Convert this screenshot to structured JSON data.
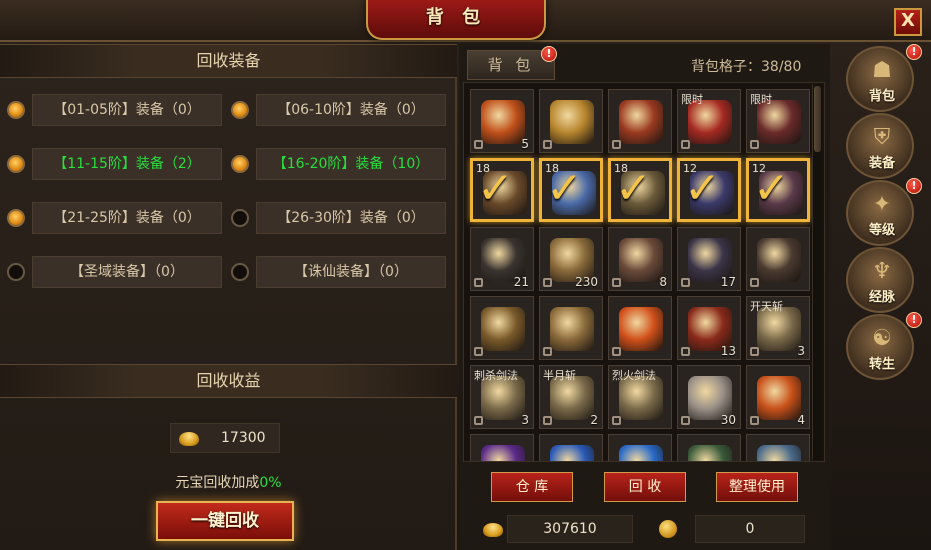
{
  "window": {
    "title": "背 包",
    "close_label": "X"
  },
  "recycle": {
    "section_title": "回收装备",
    "options": [
      {
        "label": "【01-05阶】装备（0）",
        "checked": true,
        "highlight": false
      },
      {
        "label": "【06-10阶】装备（0）",
        "checked": true,
        "highlight": false
      },
      {
        "label": "【11-15阶】装备（2）",
        "checked": true,
        "highlight": true
      },
      {
        "label": "【16-20阶】装备（10）",
        "checked": true,
        "highlight": true
      },
      {
        "label": "【21-25阶】装备（0）",
        "checked": true,
        "highlight": false
      },
      {
        "label": "【26-30阶】装备（0）",
        "checked": false,
        "highlight": false
      },
      {
        "label": "【圣域装备】（0）",
        "checked": false,
        "highlight": false
      },
      {
        "label": "【诛仙装备】（0）",
        "checked": false,
        "highlight": false
      }
    ],
    "income_title": "回收收益",
    "income_value": "17300",
    "bonus_text": "元宝回收加成",
    "bonus_pct": "0%",
    "recycle_all_label": "一键回收"
  },
  "bag": {
    "tab_label": "背 包",
    "capacity_text": "背包格子：38/80",
    "rows": [
      [
        {
          "color": "#c0501a",
          "count": "5"
        },
        {
          "color": "#b8862e",
          "count": ""
        },
        {
          "color": "#9a3a20",
          "count": ""
        },
        {
          "color": "#a52a22",
          "count": "",
          "lvl": "限时"
        },
        {
          "color": "#6a2a2a",
          "count": "",
          "lvl": "限时"
        }
      ],
      [
        {
          "color": "#6a4a2a",
          "count": "",
          "lvl": "18",
          "sel": true
        },
        {
          "color": "#4a6aa8",
          "count": "",
          "lvl": "18",
          "sel": true
        },
        {
          "color": "#6a5a3a",
          "count": "",
          "lvl": "18",
          "sel": true
        },
        {
          "color": "#3a3a6a",
          "count": "",
          "lvl": "12",
          "sel": true
        },
        {
          "color": "#5a3a4a",
          "count": "",
          "lvl": "12",
          "sel": true
        }
      ],
      [
        {
          "color": "#3a3430",
          "count": "21"
        },
        {
          "color": "#8a6a3a",
          "count": "230"
        },
        {
          "color": "#6a4a3a",
          "count": "8"
        },
        {
          "color": "#3a3448",
          "count": "17"
        },
        {
          "color": "#4a3a30",
          "count": ""
        }
      ],
      [
        {
          "color": "#7a5a2a",
          "count": ""
        },
        {
          "color": "#8a6a3a",
          "count": ""
        },
        {
          "color": "#d0501a",
          "count": ""
        },
        {
          "color": "#8a2a1a",
          "count": "13"
        },
        {
          "color": "#7a6a4a",
          "count": "3",
          "lvl": "开天斩"
        }
      ],
      [
        {
          "color": "#7a6a4a",
          "count": "3",
          "lvl": "刺杀剑法"
        },
        {
          "color": "#7a6a4a",
          "count": "2",
          "lvl": "半月斩"
        },
        {
          "color": "#7a6a4a",
          "count": "",
          "lvl": "烈火剑法"
        },
        {
          "color": "#9a9088",
          "count": "30"
        },
        {
          "color": "#c8501a",
          "count": "4"
        }
      ],
      [
        {
          "color": "#5a2a8a",
          "count": ""
        },
        {
          "color": "#2a5ab8",
          "count": ""
        },
        {
          "color": "#2a6ac8",
          "count": ""
        },
        {
          "color": "#3a5a3a",
          "count": ""
        },
        {
          "color": "#4a6a8a",
          "count": ""
        }
      ]
    ],
    "warehouse_label": "仓 库",
    "recycle_label": "回 收",
    "sort_label": "整理使用",
    "gold_value": "307610",
    "coin_value": "0"
  },
  "side_tabs": [
    {
      "label": "背包",
      "badge": "!"
    },
    {
      "label": "装备",
      "badge": ""
    },
    {
      "label": "等级",
      "badge": "!"
    },
    {
      "label": "经脉",
      "badge": ""
    },
    {
      "label": "转生",
      "badge": "!"
    }
  ],
  "colors": {
    "accent_gold": "#f0b43a",
    "highlight_green": "#27e03c",
    "button_red": "#b8231a"
  }
}
